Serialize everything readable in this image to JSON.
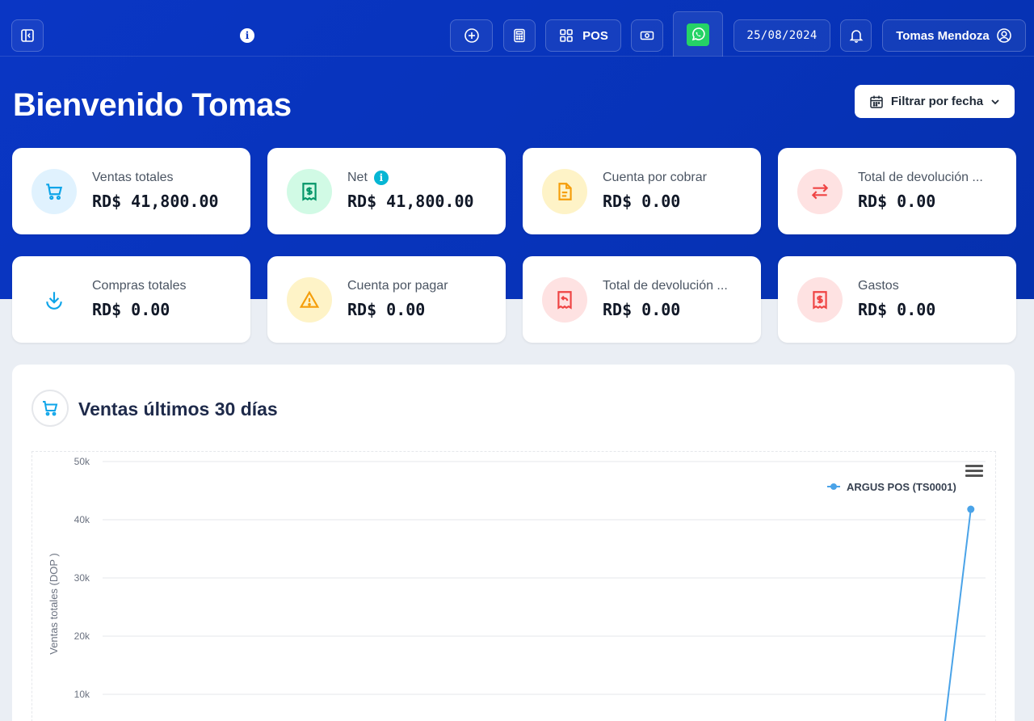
{
  "topbar": {
    "pos_label": "POS",
    "date": "25/08/2024",
    "user_name": "Tomas Mendoza"
  },
  "page": {
    "title": "Bienvenido Tomas",
    "filter_label": "Filtrar por fecha"
  },
  "stats": [
    {
      "label": "Ventas totales",
      "value": "RD$ 41,800.00",
      "icon": "cart-icon",
      "color": "#0ea5e9",
      "bg": "#e0f2fe"
    },
    {
      "label": "Net",
      "value": "RD$ 41,800.00",
      "icon": "receipt-dollar-icon",
      "color": "#059669",
      "bg": "#d1fae5"
    },
    {
      "label": "Cuenta por cobrar",
      "value": "RD$ 0.00",
      "icon": "document-icon",
      "color": "#f59e0b",
      "bg": "#fef3c7"
    },
    {
      "label": "Total de devolución ...",
      "value": "RD$ 0.00",
      "icon": "exchange-icon",
      "color": "#ef4444",
      "bg": "#fee2e2"
    },
    {
      "label": "Compras totales",
      "value": "RD$ 0.00",
      "icon": "download-icon",
      "color": "#0ea5e9",
      "bg": "#ffffff"
    },
    {
      "label": "Cuenta por pagar",
      "value": "RD$ 0.00",
      "icon": "warning-icon",
      "color": "#f59e0b",
      "bg": "#fef3c7"
    },
    {
      "label": "Total de devolución ...",
      "value": "RD$ 0.00",
      "icon": "receipt-return-icon",
      "color": "#ef4444",
      "bg": "#fee2e2"
    },
    {
      "label": "Gastos",
      "value": "RD$ 0.00",
      "icon": "receipt-dollar-icon",
      "color": "#ef4444",
      "bg": "#fee2e2"
    }
  ],
  "chart_panel": {
    "title": "Ventas últimos 30 días"
  },
  "chart_data": {
    "type": "line",
    "ylabel": "Ventas totales (DOP )",
    "ylim": [
      0,
      50000
    ],
    "yticks": [
      "10k",
      "20k",
      "30k",
      "40k",
      "50k"
    ],
    "ytick_values": [
      10000,
      20000,
      30000,
      40000,
      50000
    ],
    "grid": true,
    "legend_position": "top-right",
    "series": [
      {
        "name": "ARGUS POS (TS0001)",
        "color": "#4aa3e8",
        "points": [
          {
            "x": 14,
            "y": 0
          },
          {
            "x": 28,
            "y": 0
          },
          {
            "x": 29,
            "y": 41800
          }
        ]
      }
    ],
    "x_count": 30
  }
}
